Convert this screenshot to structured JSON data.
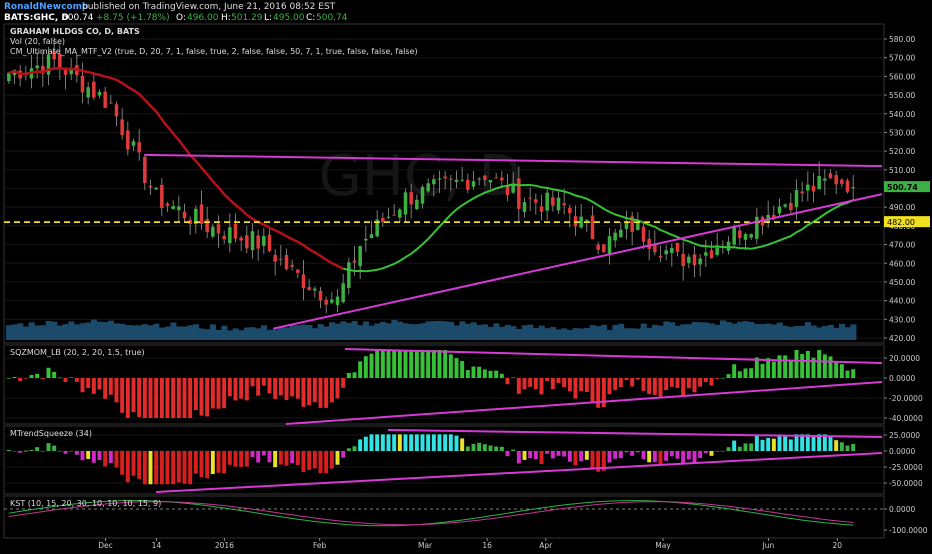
{
  "header": {
    "publisher": "RonaldNewcomb",
    "published_text": "published on TradingView.com, June 21, 2016 08:52 EST",
    "symbol": "BATS:GHC, D",
    "last": "500.74",
    "change": "+8.75 (+1.78%)",
    "o_label": "O:",
    "o_value": "496.00",
    "h_label": "H:",
    "h_value": "501.29",
    "l_label": "L:",
    "l_value": "495.00",
    "c_label": "C:",
    "c_value": "500.74"
  },
  "main_panel": {
    "title": "GRAHAM HLDGS CO, D, BATS",
    "vol_label": "Vol (20, false)",
    "ma_label": "CM_Ultimate_MA_MTF_V2 (true, D, 20, 7, 1, false, true, 2, false, false, 50, 7, 1, true, false, false, false)",
    "watermark": "GHC, D",
    "price_tag": "500.74",
    "level_tag": "482.00",
    "level_value": 482.0,
    "yticks": [
      580,
      570,
      560,
      550,
      540,
      530,
      520,
      510,
      500,
      490,
      480,
      470,
      460,
      450,
      440,
      430,
      420
    ],
    "ytick_labels": [
      "580.00",
      "570.00",
      "560.00",
      "550.00",
      "540.00",
      "530.00",
      "520.00",
      "510.00",
      "500.00",
      "490.00",
      "480.00",
      "470.00",
      "460.00",
      "450.00",
      "440.00",
      "430.00",
      "420.00"
    ]
  },
  "sqz_panel": {
    "label": "SQZMOM_LB (20, 2, 20, 1.5, true)",
    "yticks": [
      20,
      0,
      -20,
      -40
    ],
    "ytick_labels": [
      "20.0000",
      "0.0000",
      "-20.0000",
      "-40.0000"
    ]
  },
  "mtrend_panel": {
    "label": "MTrendSqueeze (34)",
    "yticks": [
      25,
      0,
      -25,
      -50
    ],
    "ytick_labels": [
      "25.0000",
      "0.0000",
      "-25.0000",
      "-50.0000"
    ]
  },
  "kst_panel": {
    "label": "KST (10, 15, 20, 30, 10, 10, 10, 15, 9)",
    "yticks": [
      0,
      -100
    ],
    "ytick_labels": [
      "0.0000",
      "-100.0000"
    ]
  },
  "x_axis": {
    "labels": [
      "Dec",
      "14",
      "2016",
      "Feb",
      "Mar",
      "16",
      "Apr",
      "May",
      "Jun",
      "20"
    ]
  },
  "colors": {
    "up": "#3cb043",
    "down": "#e03a3a",
    "ma_slow": "#b3121b",
    "ma_fast": "#36c236",
    "trendline": "#d63ad6",
    "level": "#f0e020",
    "volume": "#1b4a6b",
    "kst": "#2bb24c",
    "kst_signal": "#c0378f",
    "sqz_pos": "#36c236",
    "sqz_neg": "#e22b2b",
    "trend_cyan": "#31e3e3",
    "trend_yellow": "#e9e12f",
    "trend_magenta": "#d229c9",
    "trend_red": "#d81f1f"
  },
  "chart_data": {
    "type": "candlestick",
    "series_count": 150,
    "price_start": 560,
    "price_path": [
      [
        0,
        562
      ],
      [
        8,
        568
      ],
      [
        18,
        545
      ],
      [
        26,
        495
      ],
      [
        35,
        480
      ],
      [
        45,
        470
      ],
      [
        50,
        455
      ],
      [
        55,
        445
      ],
      [
        58,
        440
      ],
      [
        62,
        470
      ],
      [
        70,
        495
      ],
      [
        78,
        502
      ],
      [
        84,
        508
      ],
      [
        90,
        495
      ],
      [
        98,
        490
      ],
      [
        105,
        470
      ],
      [
        110,
        480
      ],
      [
        118,
        462
      ],
      [
        123,
        466
      ],
      [
        128,
        476
      ],
      [
        134,
        487
      ],
      [
        140,
        498
      ],
      [
        146,
        505
      ],
      [
        152,
        500
      ]
    ],
    "trendlines": [
      {
        "from": [
          30,
          518
        ],
        "to": [
          190,
          512
        ]
      },
      {
        "from": [
          58,
          425
        ],
        "to": [
          190,
          497
        ]
      }
    ]
  }
}
